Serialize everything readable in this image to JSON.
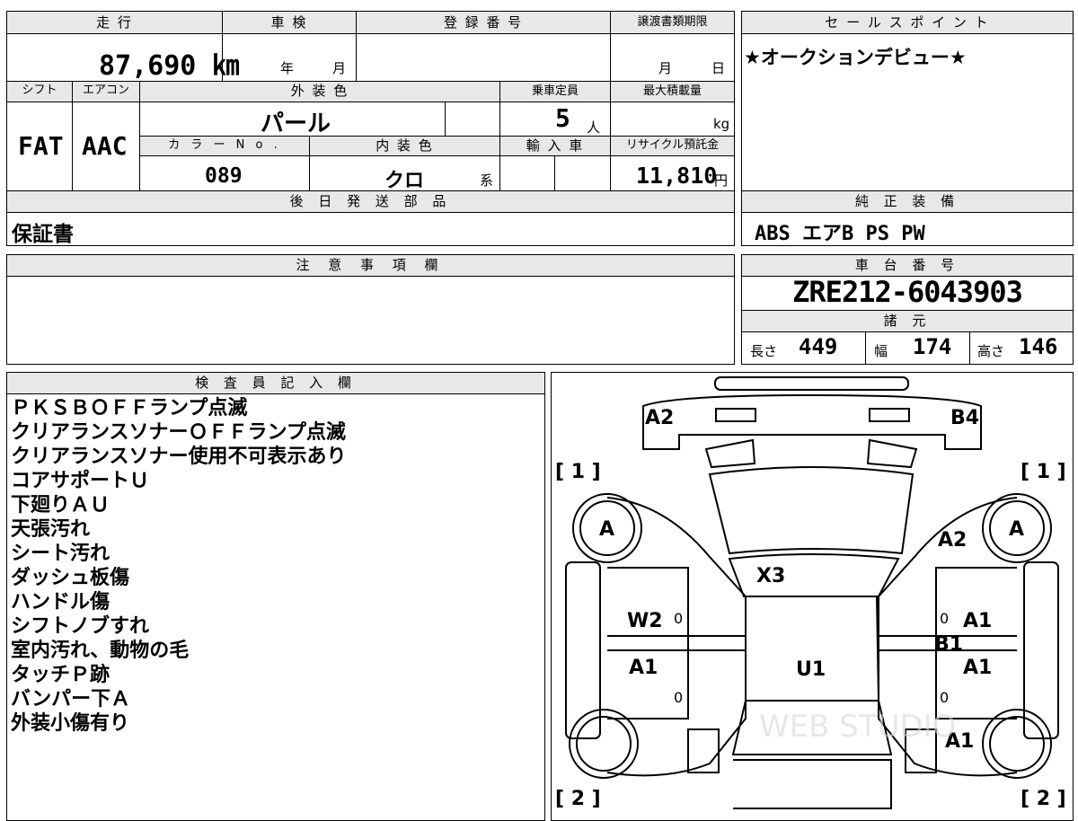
{
  "vehicle": {
    "mileage_label": "走 行",
    "mileage": "87,690 ㎞",
    "inspection_label": "車 検",
    "inspection_year_unit": "年",
    "inspection_month_unit": "月",
    "registration_label": "登 録 番 号",
    "transfer_deadline_label": "譲渡書類期限",
    "transfer_month_unit": "月",
    "transfer_day_unit": "日",
    "shift_label": "シフト",
    "shift": "FAT",
    "aircon_label": "エアコン",
    "aircon": "AAC",
    "exterior_color_label": "外 装 色",
    "exterior_color": "パール",
    "capacity_label": "乗車定員",
    "capacity": "5",
    "capacity_unit": "人",
    "max_load_label": "最大積載量",
    "max_load_unit": "kg",
    "color_no_label": "カ ラ ー N o .",
    "color_no": "089",
    "interior_color_label": "内 装 色",
    "interior_color": "クロ",
    "interior_color_suffix": "系",
    "import_label": "輸 入 車",
    "recycle_label": "リサイクル預託金",
    "recycle_fee": "11,810",
    "recycle_unit": "円",
    "later_parts_label": "後 日 発 送 部 品",
    "later_parts": "保証書",
    "caution_label": "注 意 事 項 欄",
    "sales_point_label": "セ ー ル ス ポ イ ン ト",
    "sales_point": "★オークションデビュー★",
    "equipment_label": "純 正 装 備",
    "equipment": "ABS エアB PS PW",
    "chassis_label": "車 台 番 号",
    "chassis_no": "ZRE212-6043903",
    "specs_label": "諸 元",
    "length_label": "長さ",
    "length": "449",
    "width_label": "幅",
    "width": "174",
    "height_label": "高さ",
    "height": "146",
    "inspector_label": "検 査 員 記 入 欄"
  },
  "inspector_notes": [
    "ＰＫＳＢＯＦＦランプ点滅",
    "クリアランスソナーＯＦＦランプ点滅",
    "クリアランスソナー使用不可表示あり",
    "コアサポートＵ",
    "下廻りＡＵ",
    "天張汚れ",
    "シート汚れ",
    "ダッシュ板傷",
    "ハンドル傷",
    "シフトノブすれ",
    "室内汚れ、動物の毛",
    "タッチＰ跡",
    "バンパー下Ａ",
    "外装小傷有り"
  ],
  "diagram": {
    "bracket_front_left": "[ 1 ]",
    "bracket_front_right": "[ 1 ]",
    "bracket_rear_left": "[ 2 ]",
    "bracket_rear_right": "[ 2 ]",
    "marks": {
      "front_left": "A2",
      "front_right": "B4",
      "wheel_front_left": "A",
      "wheel_front_right": "A",
      "fender_front_right": "A2",
      "windshield": "X3",
      "door_front_left": "W2",
      "door_front_left_count": "0",
      "door_front_right_count": "0",
      "door_front_right": "A1",
      "pillar_right": "B1",
      "door_rear_left": "A1",
      "door_rear_left_count": "0",
      "door_rear_right": "A1",
      "door_rear_right_count": "0",
      "roof": "U1",
      "quarter_rear_right": "A1"
    },
    "watermark": "WEB STUDIO"
  }
}
